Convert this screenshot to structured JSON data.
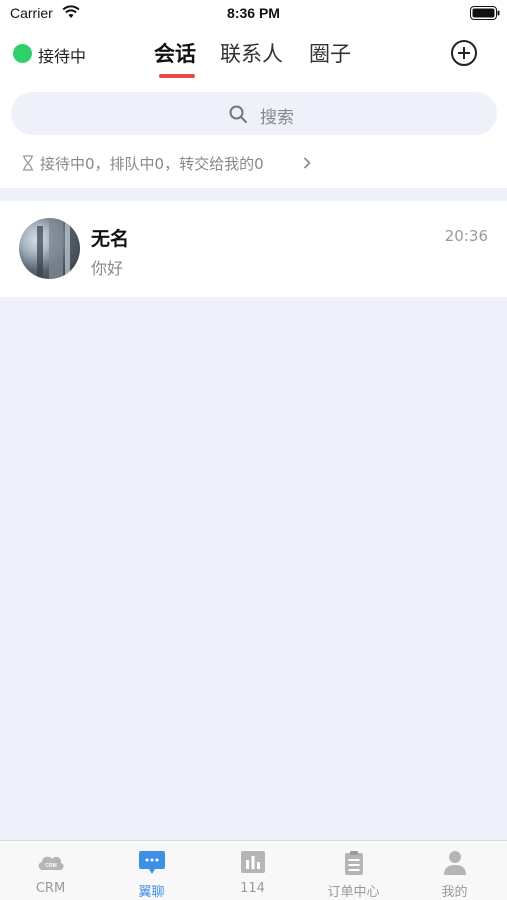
{
  "status_bar": {
    "carrier": "Carrier",
    "time": "8:36 PM"
  },
  "header": {
    "status_label": "接待中",
    "status_color": "#2fd06a",
    "tabs": [
      {
        "label": "会话",
        "active": true
      },
      {
        "label": "联系人",
        "active": false
      },
      {
        "label": "圈子",
        "active": false
      }
    ],
    "active_underline_color": "#e84848",
    "add_icon": "plus-circle-icon"
  },
  "search": {
    "placeholder": "搜索",
    "icon": "search-icon"
  },
  "queue": {
    "icon": "hourglass-icon",
    "text": "接待中0，排队中0，转交给我的0"
  },
  "conversations": [
    {
      "name": "无名",
      "last_message": "你好",
      "time": "20:36"
    }
  ],
  "bottom_nav": {
    "active_color": "#3d8fe6",
    "items": [
      {
        "label": "CRM",
        "icon": "crm-cloud-icon",
        "active": false
      },
      {
        "label": "翼聊",
        "icon": "chat-bubble-icon",
        "active": true
      },
      {
        "label": "114",
        "icon": "bar-chart-icon",
        "active": false
      },
      {
        "label": "订单中心",
        "icon": "clipboard-icon",
        "active": false
      },
      {
        "label": "我的",
        "icon": "person-icon",
        "active": false
      }
    ]
  }
}
